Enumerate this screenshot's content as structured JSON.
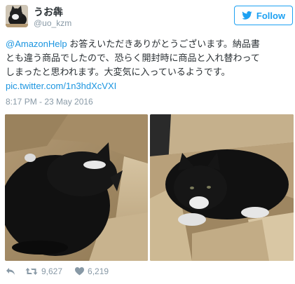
{
  "user": {
    "display_name": "うお犇",
    "handle": "@uo_kzm"
  },
  "follow_button": {
    "label": "Follow"
  },
  "tweet": {
    "mention": "@AmazonHelp",
    "text_line1": " お答えいただきありがとうございます。納品書",
    "text_line2": "とも違う商品でしたので、恐らく開封時に商品と入れ替わって",
    "text_line3": "しまったと思われます。大変気に入っているようです。",
    "link": "pic.twitter.com/1n3hdXcVXI",
    "timestamp": "8:17 PM - 23 May 2016"
  },
  "stats": {
    "retweets": "9,627",
    "likes": "6,219"
  },
  "icons": {
    "twitter_bird": "twitter-bird-icon",
    "reply": "reply-icon",
    "retweet": "retweet-icon",
    "like": "heart-icon"
  },
  "colors": {
    "accent": "#1da1f2",
    "link": "#1b95e0",
    "secondary_text": "#8899a6",
    "primary_text": "#292f33"
  }
}
